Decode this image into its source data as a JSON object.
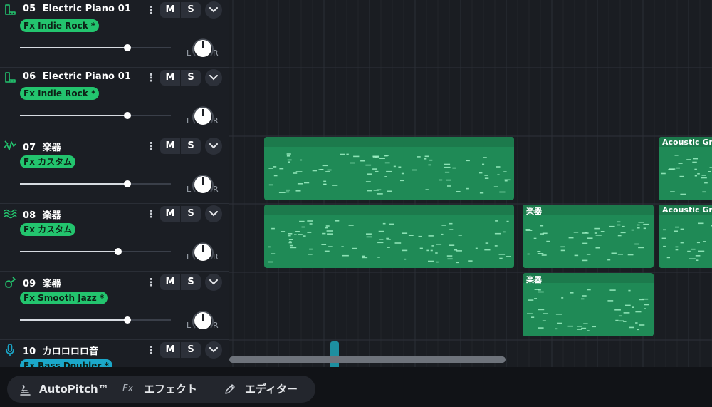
{
  "tracks": [
    {
      "num": "05",
      "name": "Electric Piano 01",
      "icon": "piano-icon",
      "fx": "Fx Indie Rock *",
      "fx_color": "#23c46e",
      "volume": 0.71,
      "mute_label": "M",
      "solo_label": "S",
      "pan_left": "L",
      "pan_right": "R"
    },
    {
      "num": "06",
      "name": "Electric Piano 01",
      "icon": "piano-icon",
      "fx": "Fx Indie Rock *",
      "fx_color": "#23c46e",
      "volume": 0.71,
      "mute_label": "M",
      "solo_label": "S",
      "pan_left": "L",
      "pan_right": "R"
    },
    {
      "num": "07",
      "name": "楽器",
      "icon": "synth-icon",
      "fx": "Fx カスタム",
      "fx_color": "#23c46e",
      "volume": 0.71,
      "mute_label": "M",
      "solo_label": "S",
      "pan_left": "L",
      "pan_right": "R"
    },
    {
      "num": "08",
      "name": "楽器",
      "icon": "wave-icon",
      "fx": "Fx カスタム",
      "fx_color": "#23c46e",
      "volume": 0.65,
      "mute_label": "M",
      "solo_label": "S",
      "pan_left": "L",
      "pan_right": "R"
    },
    {
      "num": "09",
      "name": "楽器",
      "icon": "guitar-icon",
      "fx": "Fx Smooth Jazz *",
      "fx_color": "#23c46e",
      "volume": 0.71,
      "mute_label": "M",
      "solo_label": "S",
      "pan_left": "L",
      "pan_right": "R"
    },
    {
      "num": "10",
      "name": "カロロロロ音",
      "icon": "microphone-icon",
      "fx": "Fx Bass Doubler *",
      "fx_color": "#1ba7c9",
      "volume": 0.71,
      "mute_label": "M",
      "solo_label": "S",
      "pan_left": "L",
      "pan_right": "R"
    }
  ],
  "clips": [
    {
      "track": 2,
      "label": ""
    },
    {
      "track": 2,
      "label": "Acoustic Gra"
    },
    {
      "track": 3,
      "label": ""
    },
    {
      "track": 3,
      "label": "楽器"
    },
    {
      "track": 3,
      "label": "Acoustic Gra"
    },
    {
      "track": 4,
      "label": "楽器"
    }
  ],
  "toolbar": {
    "autopitch_label": "AutoPitch™",
    "effects_label": "エフェクト",
    "fx_prefix": "Fx",
    "editor_label": "エディター"
  },
  "colors": {
    "accent_green": "#23c46e",
    "accent_blue": "#1ba7c9",
    "clip_green": "#1f8a56"
  }
}
